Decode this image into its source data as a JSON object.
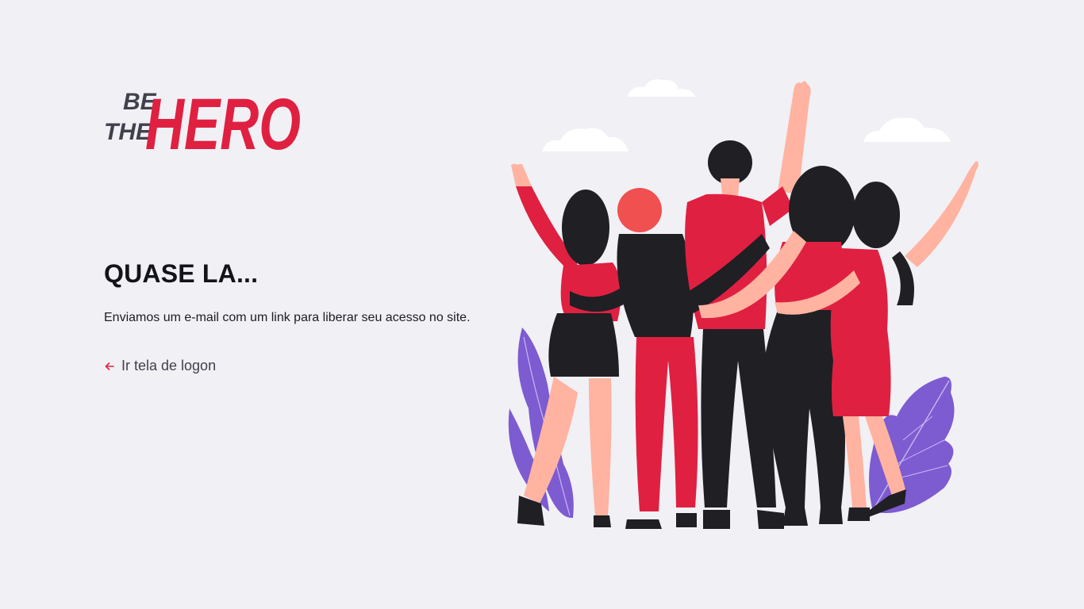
{
  "logo": {
    "line1": "BE",
    "line2": "THE",
    "word": "HERO",
    "dark_color": "#41414d",
    "brand_color": "#e02041"
  },
  "main": {
    "title": "QUASE LA...",
    "description": "Enviamos um e-mail com um link para liberar seu acesso no site.",
    "back_link": {
      "label": "Ir tela de logon",
      "icon": "arrow-left-icon"
    }
  },
  "illustration": {
    "icon": "group-of-friends-illustration",
    "colors": {
      "red": "#e02041",
      "black": "#1f1f24",
      "skin": "#ffb3a0",
      "purple": "#7d5bd0",
      "cloud": "#ffffff"
    }
  },
  "theme": {
    "background": "#f0f0f5",
    "accent": "#e02041"
  }
}
